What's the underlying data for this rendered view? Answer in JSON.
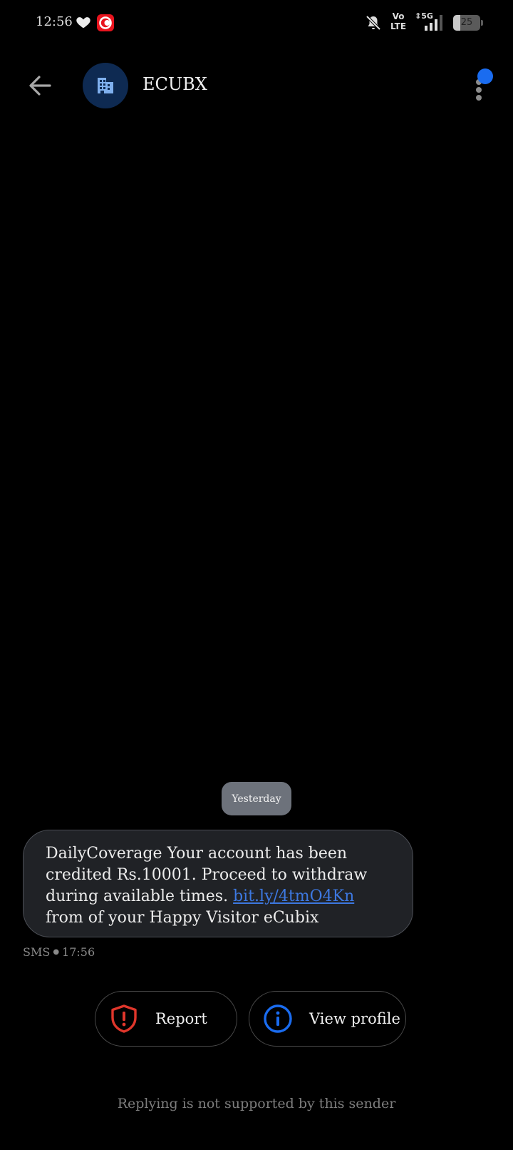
{
  "status_bar": {
    "time": "12:56",
    "volte_top": "Vo",
    "volte_bottom": "LTE",
    "network": "5G",
    "battery": "25",
    "battery_fraction": 0.25,
    "icons": [
      "heart-icon",
      "app-badge-icon",
      "bell-off-icon",
      "signal-icon"
    ]
  },
  "app_bar": {
    "sender_name": "ECUBX",
    "avatar_icon": "building-icon",
    "back_icon": "arrow-left-icon",
    "more_icon": "more-vertical-icon"
  },
  "conversation": {
    "date_label": "Yesterday",
    "message": {
      "text_before_link": "DailyCoverage Your account has been credited Rs.10001. Proceed to withdraw during available times. ",
      "link_text": "bit.ly/4tmO4Kn",
      "text_after_link": " from of your Happy Visitor eCubix",
      "channel": "SMS",
      "time": "17:56"
    }
  },
  "actions": {
    "report_label": "Report",
    "view_profile_label": "View profile"
  },
  "footer": {
    "reply_note": "Replying is not supported by this sender"
  },
  "colors": {
    "background": "#000000",
    "accent_blue": "#1a6cf0",
    "report_red": "#e0362b",
    "link_blue": "#3d78e0",
    "bubble": "#202226"
  }
}
